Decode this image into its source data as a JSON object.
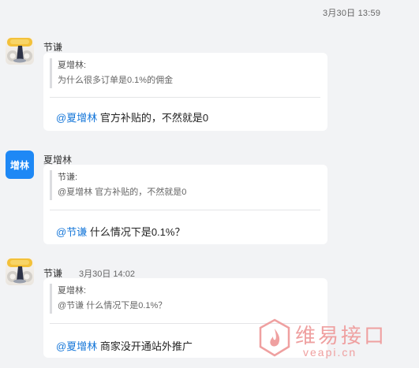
{
  "top_timestamp": "3月30日 13:59",
  "messages": [
    {
      "sender": "节谦",
      "time": "",
      "quote_author": "夏增林:",
      "quote_text": "为什么很多订单是0.1%的佣金",
      "mention": "@夏增林",
      "reply": " 官方补贴的，不然就是0"
    },
    {
      "sender": "夏增林",
      "avatar_text": "增林",
      "time": "",
      "quote_author": "节谦:",
      "quote_text": "@夏增林 官方补贴的，不然就是0",
      "mention": "@节谦",
      "reply": " 什么情况下是0.1%？"
    },
    {
      "sender": "节谦",
      "time": "3月30日 14:02",
      "quote_author": "夏增林:",
      "quote_text": "@节谦 什么情况下是0.1%？",
      "mention": "@夏增林",
      "reply": " 商家没开通站外推广"
    }
  ],
  "watermark": {
    "title": "维易接口",
    "url": "veapi.cn",
    "color": "#efa0a0"
  },
  "colors": {
    "background": "#f2f3f5",
    "mention": "#1677d9",
    "avatar_blue": "#1e88f5"
  }
}
